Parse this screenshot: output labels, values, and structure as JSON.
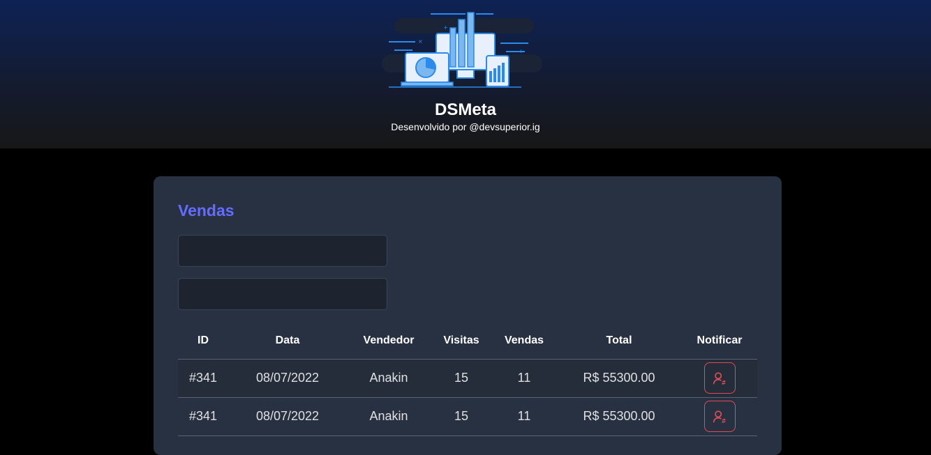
{
  "header": {
    "title": "DSMeta",
    "subtitle": "Desenvolvido por @devsuperior.ig"
  },
  "sales": {
    "title": "Vendas",
    "min_date": "",
    "max_date": "",
    "columns": [
      "ID",
      "Data",
      "Vendedor",
      "Visitas",
      "Vendas",
      "Total",
      "Notificar"
    ],
    "rows": [
      {
        "id": "#341",
        "date": "08/07/2022",
        "seller": "Anakin",
        "visits": "15",
        "deals": "11",
        "amount": "R$ 55300.00"
      },
      {
        "id": "#341",
        "date": "08/07/2022",
        "seller": "Anakin",
        "visits": "15",
        "deals": "11",
        "amount": "R$ 55300.00"
      }
    ]
  },
  "colors": {
    "accent": "#646cff",
    "notify": "#e24d55",
    "card": "#283142"
  },
  "icons": {
    "logo": "dashboard-devices-icon",
    "notify": "user-notify-icon"
  }
}
